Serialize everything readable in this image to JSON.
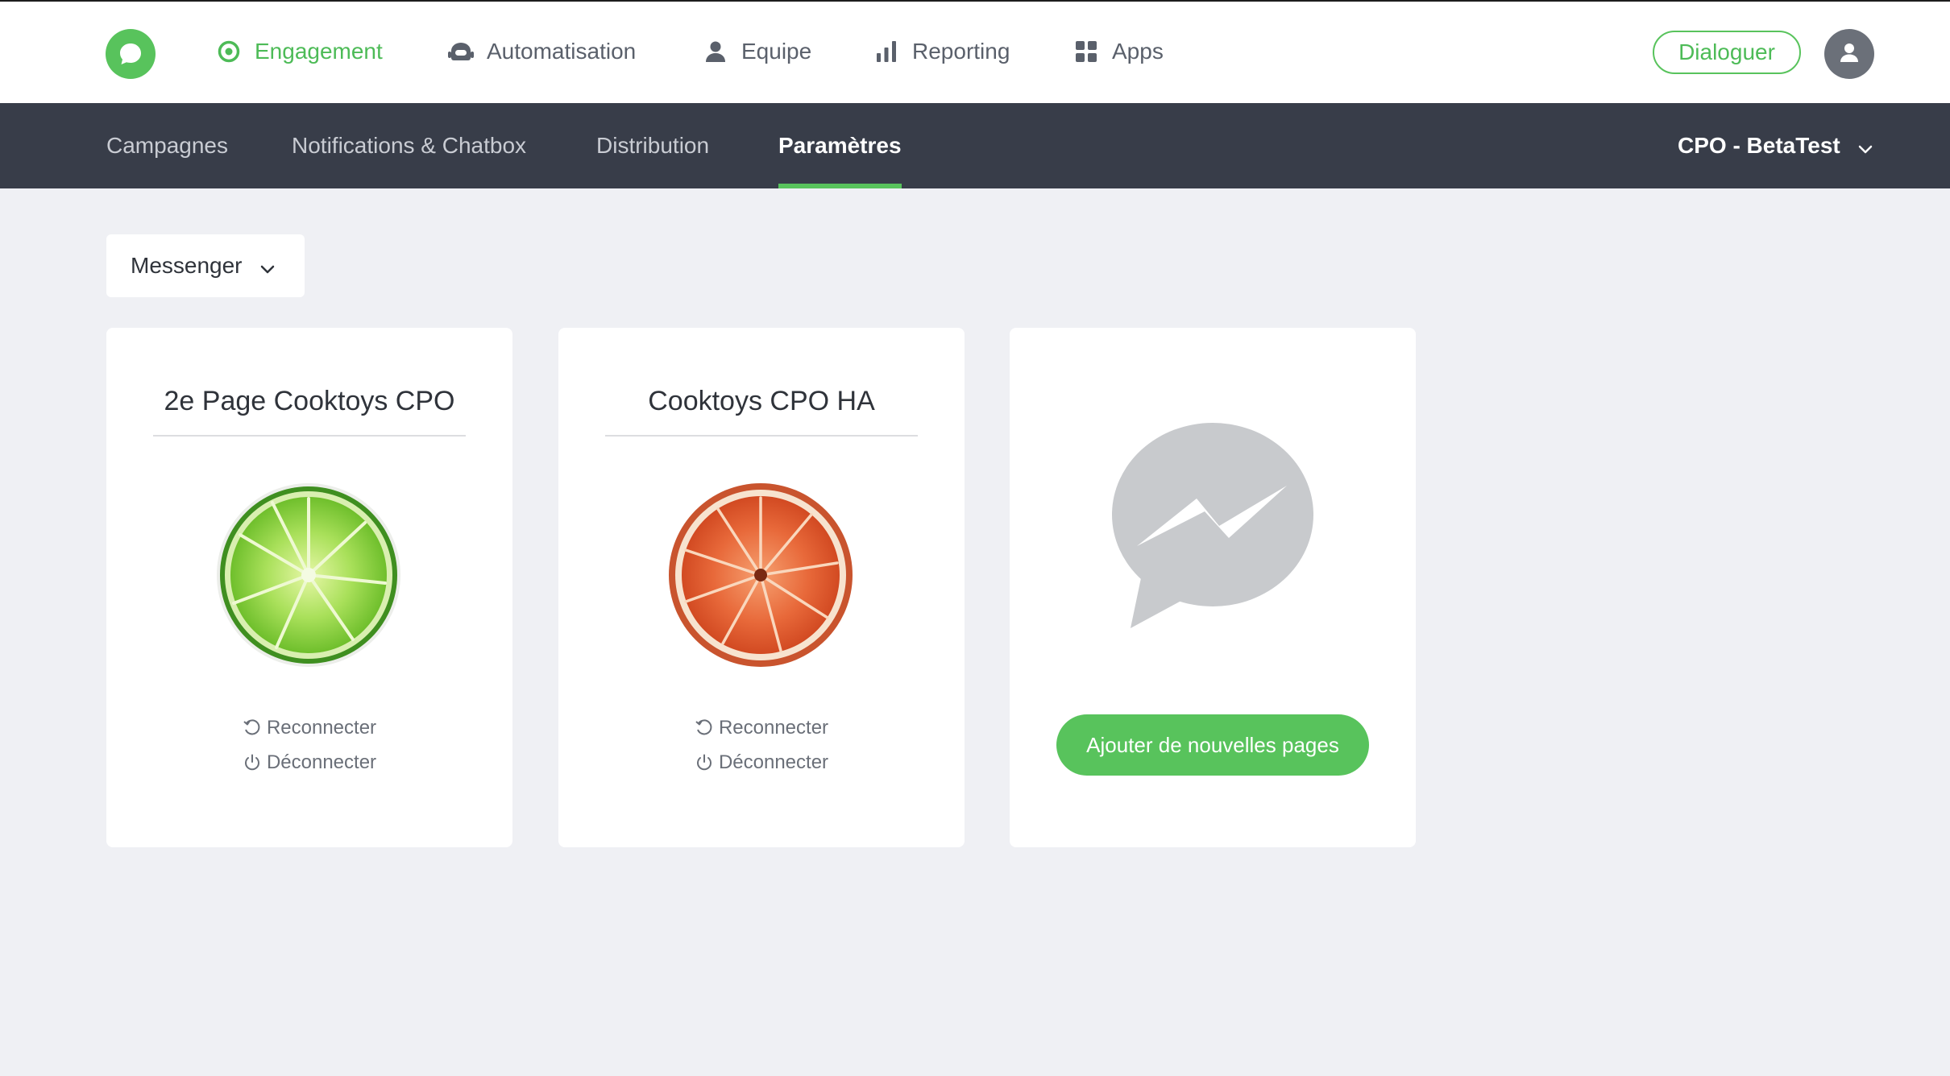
{
  "topnav": {
    "items": [
      {
        "label": "Engagement",
        "icon": "target-icon"
      },
      {
        "label": "Automatisation",
        "icon": "robot-icon"
      },
      {
        "label": "Equipe",
        "icon": "user-icon"
      },
      {
        "label": "Reporting",
        "icon": "bar-chart-icon"
      },
      {
        "label": "Apps",
        "icon": "grid-icon"
      }
    ],
    "active": "Engagement",
    "dialog_button": "Dialoguer"
  },
  "subnav": {
    "items": [
      "Campagnes",
      "Notifications & Chatbox",
      "Distribution",
      "Paramètres"
    ],
    "active": "Paramètres",
    "org_selector": "CPO - BetaTest"
  },
  "channel_selector": {
    "value": "Messenger"
  },
  "pages": [
    {
      "title": "2e Page Cooktoys CPO",
      "image": "lime",
      "reconnect_label": "Reconnecter",
      "disconnect_label": "Déconnecter"
    },
    {
      "title": "Cooktoys CPO HA",
      "image": "grapefruit",
      "reconnect_label": "Reconnecter",
      "disconnect_label": "Déconnecter"
    }
  ],
  "add_card": {
    "icon": "messenger-icon",
    "button_label": "Ajouter de nouvelles pages"
  },
  "colors": {
    "accent": "#58c35c",
    "subnav_bg": "#383d49",
    "page_bg": "#eff0f4"
  }
}
